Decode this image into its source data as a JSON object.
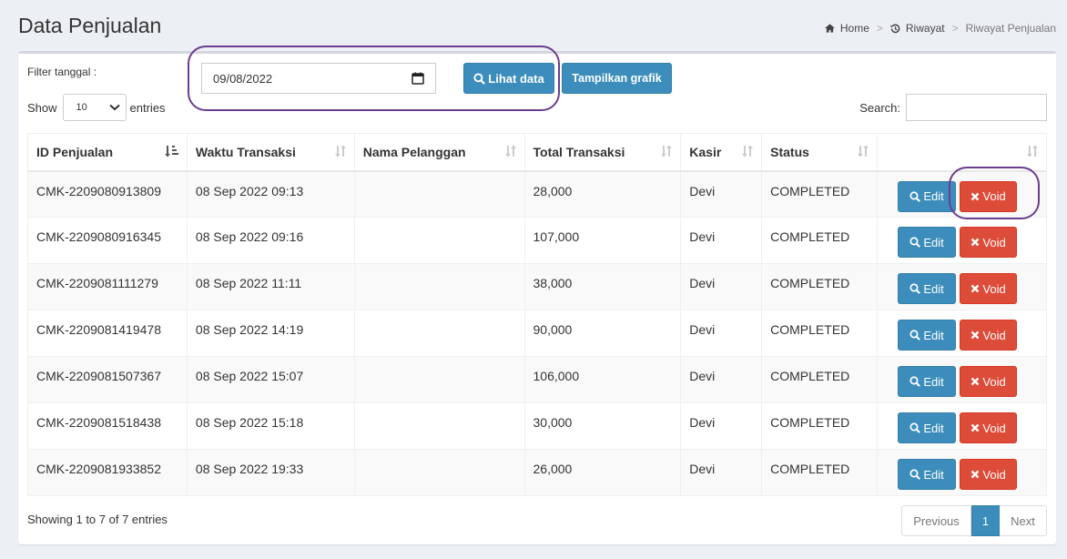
{
  "header": {
    "title": "Data Penjualan",
    "breadcrumb": {
      "home": "Home",
      "riwayat": "Riwayat",
      "current": "Riwayat Penjualan"
    }
  },
  "filter": {
    "label": "Filter tanggal :",
    "date_value": "09/08/2022",
    "lihat_label": "Lihat data",
    "grafik_label": "Tampilkan grafik"
  },
  "entries": {
    "show": "Show",
    "value": "10",
    "suffix": "entries"
  },
  "search": {
    "label": "Search:",
    "value": ""
  },
  "table": {
    "headers": [
      "ID Penjualan",
      "Waktu Transaksi",
      "Nama Pelanggan",
      "Total Transaksi",
      "Kasir",
      "Status",
      ""
    ],
    "edit_label": "Edit",
    "void_label": "Void",
    "rows": [
      {
        "id": "CMK-2209080913809",
        "waktu": "08 Sep 2022 09:13",
        "pelanggan": "",
        "total": "28,000",
        "kasir": "Devi",
        "status": "COMPLETED"
      },
      {
        "id": "CMK-2209080916345",
        "waktu": "08 Sep 2022 09:16",
        "pelanggan": "",
        "total": "107,000",
        "kasir": "Devi",
        "status": "COMPLETED"
      },
      {
        "id": "CMK-2209081111279",
        "waktu": "08 Sep 2022 11:11",
        "pelanggan": "",
        "total": "38,000",
        "kasir": "Devi",
        "status": "COMPLETED"
      },
      {
        "id": "CMK-2209081419478",
        "waktu": "08 Sep 2022 14:19",
        "pelanggan": "",
        "total": "90,000",
        "kasir": "Devi",
        "status": "COMPLETED"
      },
      {
        "id": "CMK-2209081507367",
        "waktu": "08 Sep 2022 15:07",
        "pelanggan": "",
        "total": "106,000",
        "kasir": "Devi",
        "status": "COMPLETED"
      },
      {
        "id": "CMK-2209081518438",
        "waktu": "08 Sep 2022 15:18",
        "pelanggan": "",
        "total": "30,000",
        "kasir": "Devi",
        "status": "COMPLETED"
      },
      {
        "id": "CMK-2209081933852",
        "waktu": "08 Sep 2022 19:33",
        "pelanggan": "",
        "total": "26,000",
        "kasir": "Devi",
        "status": "COMPLETED"
      }
    ]
  },
  "footer": {
    "info": "Showing 1 to 7 of 7 entries",
    "previous": "Previous",
    "page": "1",
    "next": "Next"
  },
  "colors": {
    "primary": "#3c8dbc",
    "danger": "#dd4b39",
    "highlight": "#6b3d8e"
  }
}
